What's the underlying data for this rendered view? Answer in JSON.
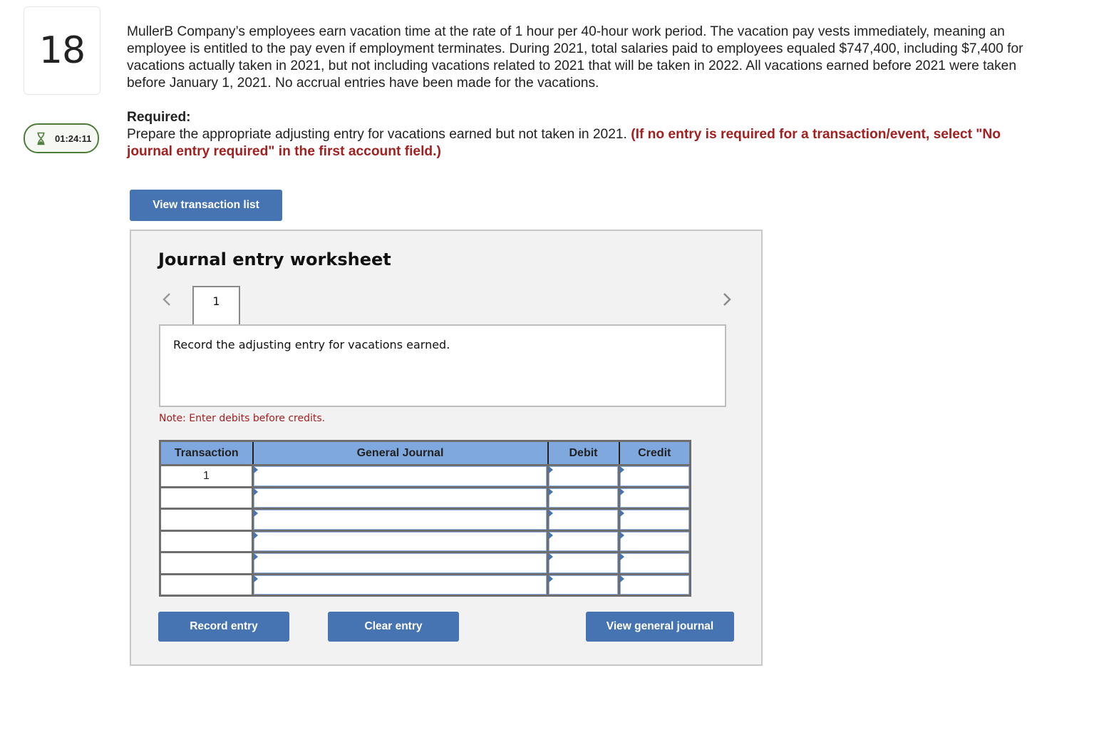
{
  "question": {
    "number": "18",
    "timer": "01:24:11",
    "timer_icon": "hourglass-icon",
    "text": "MullerB Company’s employees earn vacation time at the rate of 1 hour per 40-hour work period. The vacation pay vests immediately, meaning an employee is entitled to the pay even if employment terminates. During 2021, total salaries paid to employees equaled $747,400, including $7,400 for vacations actually taken in 2021, but not including vacations related to 2021 that will be taken in 2022. All vacations earned before 2021 were taken before January 1, 2021. No accrual entries have been made for the vacations.",
    "required_label": "Required:",
    "required_text": "Prepare the appropriate adjusting entry for vacations earned but not taken in 2021.",
    "required_instruction": "(If no entry is required for a transaction/event, select \"No journal entry required\" in the first account field.)"
  },
  "buttons": {
    "view_transaction_list": "View transaction list",
    "record_entry": "Record entry",
    "clear_entry": "Clear entry",
    "view_general_journal": "View general journal"
  },
  "worksheet": {
    "title": "Journal entry worksheet",
    "prev_icon": "chevron-left-icon",
    "next_icon": "chevron-right-icon",
    "tabs": [
      {
        "label": "1",
        "active": true
      }
    ],
    "description": "Record the adjusting entry for vacations earned.",
    "note": "Note: Enter debits before credits.",
    "table": {
      "headers": [
        "Transaction",
        "General Journal",
        "Debit",
        "Credit"
      ],
      "rows": [
        {
          "transaction": "1",
          "account": "",
          "debit": "",
          "credit": ""
        },
        {
          "transaction": "",
          "account": "",
          "debit": "",
          "credit": ""
        },
        {
          "transaction": "",
          "account": "",
          "debit": "",
          "credit": ""
        },
        {
          "transaction": "",
          "account": "",
          "debit": "",
          "credit": ""
        },
        {
          "transaction": "",
          "account": "",
          "debit": "",
          "credit": ""
        },
        {
          "transaction": "",
          "account": "",
          "debit": "",
          "credit": ""
        }
      ]
    }
  },
  "colors": {
    "accent_blue": "#4674b3",
    "header_blue": "#7fa8df",
    "timer_green": "#4e7c3a",
    "warning_red": "#a32020"
  }
}
